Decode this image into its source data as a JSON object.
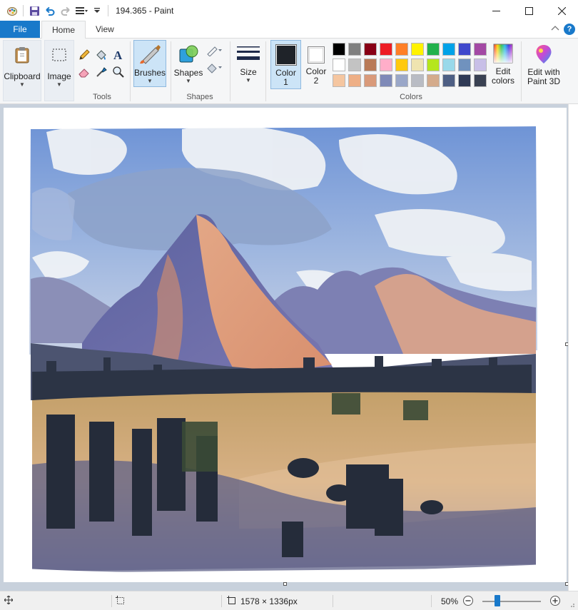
{
  "window": {
    "title": "194.365 - Paint"
  },
  "tabs": {
    "file": "File",
    "home": "Home",
    "view": "View"
  },
  "ribbon": {
    "clipboard": "Clipboard",
    "image": "Image",
    "tools_group": "Tools",
    "brushes": "Brushes",
    "shapes": "Shapes",
    "shapes_group": "Shapes",
    "size": "Size",
    "color1": "Color 1",
    "color2": "Color 2",
    "colors_group": "Colors",
    "edit_colors": "Edit colors",
    "edit_paint3d": "Edit with Paint 3D"
  },
  "current_colors": {
    "color1": "#1f2329",
    "color2": "#ffffff"
  },
  "palette": [
    "#000000",
    "#7f7f7f",
    "#880015",
    "#ed1c24",
    "#ff7f27",
    "#fff200",
    "#22b14c",
    "#00a2e8",
    "#3f48cc",
    "#a349a4",
    "#ffffff",
    "#c3c3c3",
    "#b97a57",
    "#ffaec9",
    "#ffc90e",
    "#efe4b0",
    "#b5e61d",
    "#99d9ea",
    "#7092be",
    "#c8bfe7",
    "#f5c6a0",
    "#eeaf86",
    "#d99a7a",
    "#7f8ab8",
    "#9aa7c8",
    "#b9bcc4",
    "#d4ab8c",
    "#4e5f84",
    "#2f3a55",
    "#394152"
  ],
  "status": {
    "canvas_size": "1578 × 1336px",
    "zoom": "50%",
    "zoom_fraction": 0.25
  }
}
